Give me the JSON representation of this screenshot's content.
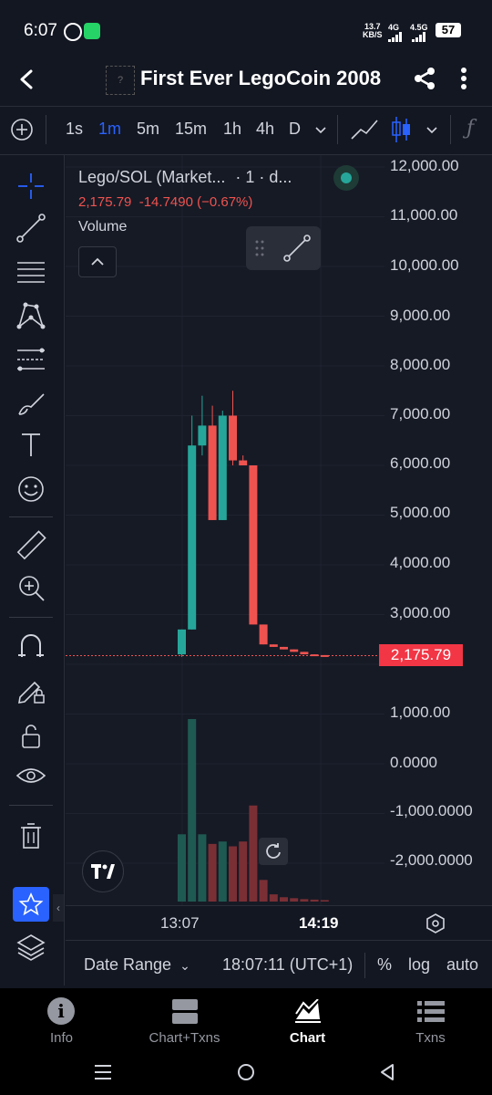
{
  "status_bar": {
    "time": "6:07",
    "network_speed_top": "13.7",
    "network_speed_bottom": "KB/S",
    "network_a": "4G",
    "network_b": "4.5G",
    "battery": "57"
  },
  "header": {
    "title": "First Ever LegoCoin 2008"
  },
  "toolbar": {
    "timeframes": [
      "1s",
      "1m",
      "5m",
      "15m",
      "1h",
      "4h",
      "D"
    ],
    "active_timeframe": "1m"
  },
  "chart": {
    "symbol_line": "Lego/SOL (Market...",
    "symbol_suffix": "· 1 · d...",
    "price_line": "2,175.79  -14.7490 (−0.67%)",
    "volume_label": "Volume",
    "current_price_tag": "2,175.79",
    "y_axis_labels": [
      "12,000.00",
      "11,000.00",
      "10,000.00",
      "9,000.00",
      "8,000.00",
      "7,000.00",
      "6,000.00",
      "5,000.00",
      "4,000.00",
      "3,000.00",
      "1,000.00",
      "0.0000",
      "-1,000.0000",
      "-2,000.0000"
    ],
    "x_axis_labels": [
      "13:07",
      "14:19"
    ]
  },
  "chart_data": {
    "type": "candlestick",
    "series": [
      {
        "open": 2200,
        "high": 2700,
        "low": 2150,
        "close": 2700,
        "volume": 1400
      },
      {
        "open": 2700,
        "high": 7000,
        "low": 2700,
        "close": 6400,
        "volume": 3800
      },
      {
        "open": 6400,
        "high": 7400,
        "low": 6200,
        "close": 6800,
        "volume": 1400
      },
      {
        "open": 6800,
        "high": 7200,
        "low": 4900,
        "close": 4900,
        "volume": 1200
      },
      {
        "open": 4900,
        "high": 7100,
        "low": 4900,
        "close": 7000,
        "volume": 1250
      },
      {
        "open": 7000,
        "high": 7500,
        "low": 6000,
        "close": 6100,
        "volume": 1150
      },
      {
        "open": 6100,
        "high": 6200,
        "low": 6000,
        "close": 6000,
        "volume": 1250
      },
      {
        "open": 6000,
        "high": 6000,
        "low": 2800,
        "close": 2800,
        "volume": 2000
      },
      {
        "open": 2800,
        "high": 2800,
        "low": 2400,
        "close": 2400,
        "volume": 450
      },
      {
        "open": 2400,
        "high": 2400,
        "low": 2350,
        "close": 2350,
        "volume": 150
      },
      {
        "open": 2350,
        "high": 2350,
        "low": 2300,
        "close": 2300,
        "volume": 90
      },
      {
        "open": 2300,
        "high": 2300,
        "low": 2250,
        "close": 2250,
        "volume": 70
      },
      {
        "open": 2250,
        "high": 2250,
        "low": 2200,
        "close": 2200,
        "volume": 50
      },
      {
        "open": 2200,
        "high": 2200,
        "low": 2185,
        "close": 2185,
        "volume": 40
      },
      {
        "open": 2185,
        "high": 2185,
        "low": 2175,
        "close": 2175,
        "volume": 30
      }
    ],
    "ylim": [
      -2500,
      12000
    ],
    "up_color": "#26a69a",
    "down_color": "#ef5350"
  },
  "bottom_bar": {
    "date_range": "Date Range",
    "time": "18:07:11 (UTC+1)",
    "percent": "%",
    "log": "log",
    "auto": "auto"
  },
  "bottom_nav": [
    {
      "label": "Info",
      "icon": "info-icon"
    },
    {
      "label": "Chart+Txns",
      "icon": "chart-txns-icon"
    },
    {
      "label": "Chart",
      "icon": "chart-icon"
    },
    {
      "label": "Txns",
      "icon": "list-icon"
    }
  ],
  "active_nav": "Chart"
}
